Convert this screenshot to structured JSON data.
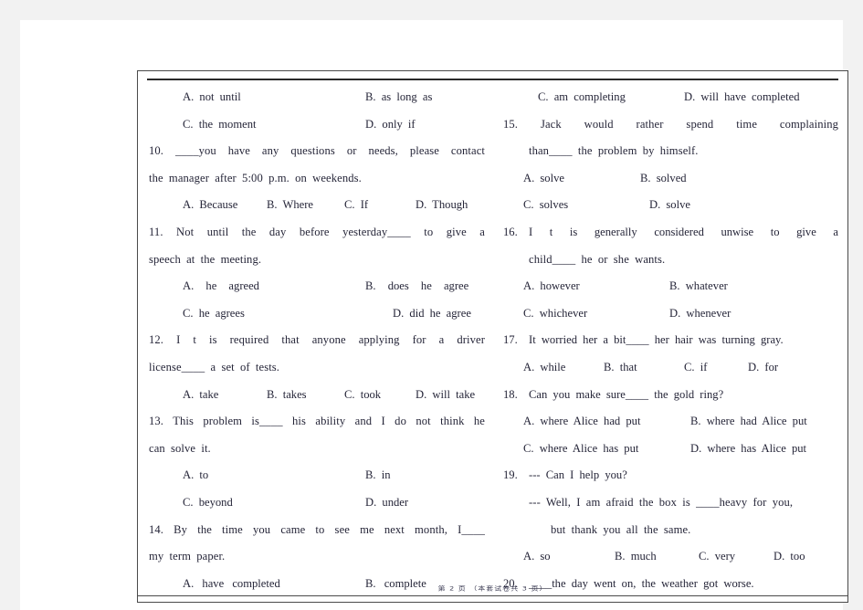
{
  "document": {
    "type": "exam-paper-scan",
    "footer": "第 2 页 （本套试卷共 3 页）",
    "text_color": "#252538",
    "page_background": "#ffffff",
    "backdrop_color": "#f2f2f2"
  },
  "left_column": {
    "q9_options": {
      "a": "A. not until",
      "b": "B. as long as",
      "c": "C. the moment",
      "d": "D. only if"
    },
    "q10": {
      "stem_line1": "10. ____you have any questions or needs, please contact",
      "stem_line2": "the manager after 5:00 p.m. on weekends.",
      "a": "A. Because",
      "b": "B. Where",
      "c": "C. If",
      "d": "D. Though"
    },
    "q11": {
      "stem_line1": "11. Not until the day before yesterday____ to give a",
      "stem_line2": "speech at the meeting.",
      "a": "A.  he  agreed",
      "b": "B.  does  he  agree",
      "c": "C. he agrees",
      "d": "D. did he agree"
    },
    "q12": {
      "stem_line1": "12. I t is required that anyone applying for a driver",
      "stem_line2": "license____ a set of tests.",
      "a": "A. take",
      "b": "B. takes",
      "c": "C. took",
      "d": "D. will take"
    },
    "q13": {
      "stem_line1": "13. This problem is____ his ability and I do not think he",
      "stem_line2": "can solve it.",
      "a": "A. to",
      "b": "B. in",
      "c": "C. beyond",
      "d": "D. under"
    },
    "q14": {
      "stem_line1": "14. By the time you came to see me next month, I____",
      "stem_line2": "my term paper.",
      "a": "A.   have   completed",
      "b": "B.   complete"
    }
  },
  "right_column": {
    "q14_options_cont": {
      "c": "C. am completing",
      "d": "D. will have completed"
    },
    "q15": {
      "stem_line1": "15.   Jack   would   rather   spend   time   complaining",
      "stem_line2": "than____ the problem by himself.",
      "number": "15.",
      "a": "A. solve",
      "b": "B. solved",
      "c": "C. solves",
      "d": "D. solve"
    },
    "q16": {
      "number": "16.",
      "stem_line1": "I t  is  generally  considered  unwise  to  give  a",
      "stem_line2": "child____ he or she wants.",
      "a": "A. however",
      "b": "B. whatever",
      "c": "C. whichever",
      "d": "D. whenever"
    },
    "q17": {
      "number": "17.",
      "stem_line1": "It worried her a bit____ her hair was turning gray.",
      "a": "A. while",
      "b": "B. that",
      "c": "C. if",
      "d": "D. for"
    },
    "q18": {
      "number": "18.",
      "stem_line1": "Can you make sure____ the gold ring?",
      "a": "A. where Alice had put",
      "b": "B. where had Alice put",
      "c": "C. where Alice has put",
      "d": "D. where has Alice put"
    },
    "q19": {
      "number": "19.",
      "stem_line1": "--- Can I help you?",
      "stem_line2": "--- Well, I am afraid the box is ____heavy for you,",
      "stem_line3": "but thank you all the same.",
      "a": "A. so",
      "b": "B. much",
      "c": "C. very",
      "d": "D. too"
    },
    "q20": {
      "number": "20.",
      "stem_line1": "____the day went on, the weather got worse."
    }
  }
}
